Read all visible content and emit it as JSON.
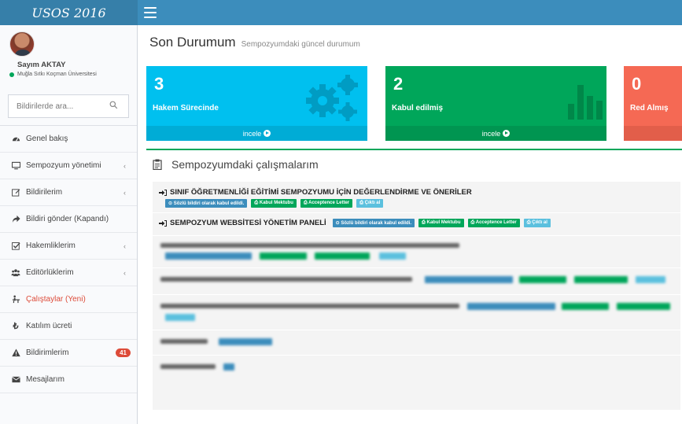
{
  "app": {
    "logo_text": "USOS 2016"
  },
  "user": {
    "name": "Sayım AKTAY",
    "org": "Muğla Sıtkı Koçman Üniversitesi",
    "status_color": "#00a65a"
  },
  "search": {
    "placeholder": "Bildirilerde ara..."
  },
  "sidebar": {
    "items": [
      {
        "label": "Genel bakış",
        "icon": "dashboard-icon"
      },
      {
        "label": "Sempozyum yönetimi",
        "icon": "monitor-icon",
        "has_submenu": true
      },
      {
        "label": "Bildirilerim",
        "icon": "edit-icon",
        "has_submenu": true
      },
      {
        "label": "Bildiri gönder (Kapandı)",
        "icon": "share-icon"
      },
      {
        "label": "Hakemliklerim",
        "icon": "checkbox-icon",
        "has_submenu": true
      },
      {
        "label": "Editörlüklerim",
        "icon": "users-icon",
        "has_submenu": true
      },
      {
        "label": "Çalıştaylar (Yeni)",
        "icon": "workshop-icon",
        "highlight_color": "#dd4b39"
      },
      {
        "label": "Katılım ücreti",
        "icon": "lira-icon"
      },
      {
        "label": "Bildirimlerim",
        "icon": "warning-icon",
        "badge": "41"
      },
      {
        "label": "Mesajlarım",
        "icon": "envelope-icon"
      }
    ]
  },
  "header": {
    "title": "Son Durumum",
    "subtitle": "Sempozyumdaki güncel durumum"
  },
  "stats": [
    {
      "value": "3",
      "label": "Hakem Sürecinde",
      "link": "incele",
      "color": "#00c0ef"
    },
    {
      "value": "2",
      "label": "Kabul edilmiş",
      "link": "incele",
      "color": "#00a65a"
    },
    {
      "value": "0",
      "label": "Red Almış",
      "color": "#f56954"
    }
  ],
  "works": {
    "title": "Sempozyumdaki çalışmalarım",
    "items": [
      {
        "title": "SINIF ÖĞRETMENLİĞİ EĞİTİMİ SEMPOZYUMU İÇİN DEĞERLENDİRME VE ÖNERİLER",
        "tags": [
          "Sözlü bildiri olarak kabul edildi.",
          "Kabul Mektubu",
          "Acceptence Letter",
          "Çıktı al"
        ]
      },
      {
        "title": "SEMPOZYUM WEBSİTESİ YÖNETİM PANELİ",
        "tags": [
          "Sözlü bildiri olarak kabul edildi.",
          "Kabul Mektubu",
          "Acceptence Letter",
          "Çıktı al"
        ]
      }
    ]
  },
  "colors": {
    "topbar": "#3c8dbc",
    "logo_bg": "#367fa9",
    "accent_green": "#00a65a",
    "accent_blue": "#3c8dbc",
    "accent_aqua": "#5bc0de"
  }
}
